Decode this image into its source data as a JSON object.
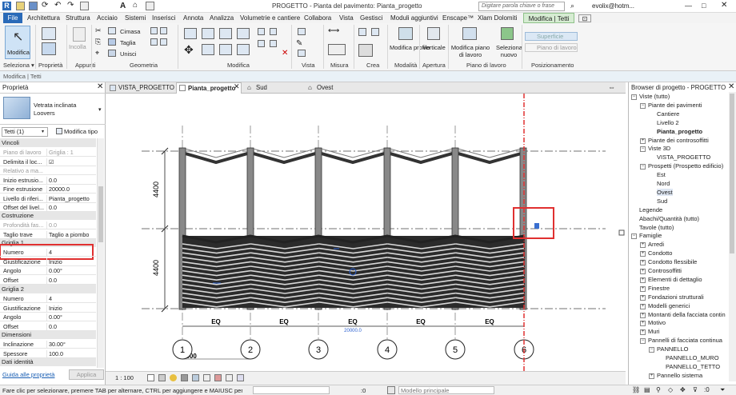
{
  "titlebar": {
    "title": "PROGETTO - Pianta del pavimento: Pianta_progetto",
    "search_placeholder": "Digitare parola chiave o frase",
    "user": "evolix@hotm..."
  },
  "tabs": [
    "File",
    "Architettura",
    "Struttura",
    "Acciaio",
    "Sistemi",
    "Inserisci",
    "Annota",
    "Analizza",
    "Volumetrie e cantiere",
    "Collabora",
    "Vista",
    "Gestisci",
    "Moduli aggiuntivi",
    "Enscape™",
    "Xlam Dolomiti",
    "Modifica | Tetti"
  ],
  "ribbon": {
    "modifica": "Modifica",
    "incolla": "Incolla",
    "cimasa": "Cimasa",
    "taglia": "Taglia",
    "unisci": "Unisci",
    "modifica_profilo": "Modifica profilo",
    "verticale": "Verticale",
    "modifica_piano": "Modifica piano di lavoro",
    "seleziona_nuovo": "Seleziona nuovo",
    "superficie": "Superficie",
    "piano_di_lavoro": "Piano di lavoro",
    "groups": [
      "Seleziona ▾",
      "Proprietà",
      "Appunti",
      "Geometria",
      "Modifica",
      "Vista",
      "Misura",
      "Crea",
      "Modalità",
      "Apertura",
      "Piano di lavoro",
      "Posizionamento"
    ]
  },
  "context_bar": "Modifica | Tetti",
  "properties": {
    "title": "Proprietà",
    "type_name": "Vetrata inclinata Loovers",
    "selector": "Tetti (1)",
    "edit_type": "Modifica tipo",
    "sections": {
      "vincoli": "Vincoli",
      "costruzione": "Costruzione",
      "griglia1": "Griglia 1",
      "griglia2": "Griglia 2",
      "dimensioni": "Dimensioni",
      "dati_identita": "Dati identità"
    },
    "rows_vincoli": [
      [
        "Piano di lavoro",
        "Griglia : 1"
      ],
      [
        "Delimita il loc...",
        "☑"
      ],
      [
        "Relativo a ma...",
        ""
      ],
      [
        "Inizio estrusio...",
        "0.0"
      ],
      [
        "Fine estrusione",
        "20000.0"
      ],
      [
        "Livello di riferi...",
        "Pianta_progetto"
      ],
      [
        "Offset del livel...",
        "0.0"
      ]
    ],
    "rows_costruzione": [
      [
        "Profondità fas...",
        "0.0"
      ],
      [
        "Taglio trave",
        "Taglio a piombo"
      ]
    ],
    "rows_griglia1": [
      [
        "Numero",
        "4"
      ],
      [
        "Giustificazione",
        "Inizio"
      ],
      [
        "Angolo",
        "0.00°"
      ],
      [
        "Offset",
        "0.0"
      ]
    ],
    "rows_griglia2": [
      [
        "Numero",
        "4"
      ],
      [
        "Giustificazione",
        "Inizio"
      ],
      [
        "Angolo",
        "0.00°"
      ],
      [
        "Offset",
        "0.0"
      ]
    ],
    "rows_dimensioni": [
      [
        "Inclinazione",
        "30.00°"
      ],
      [
        "Spessore",
        "100.0"
      ]
    ],
    "help_link": "Guida alle proprietà",
    "apply": "Applica"
  },
  "view_tabs": [
    "VISTA_PROGETTO",
    "Pianta_progetto",
    "Sud",
    "Ovest"
  ],
  "drawing": {
    "dim_left_top": "4400",
    "dim_left_bottom": "4400",
    "eq": "EQ",
    "overall": "20000.0",
    "bay": "4000",
    "grids": [
      "1",
      "2",
      "3",
      "4",
      "5",
      "6"
    ]
  },
  "browser": {
    "title": "Browser di progetto - PROGETTO",
    "items": [
      {
        "t": "Viste (tutto)",
        "l": 1,
        "e": "−"
      },
      {
        "t": "Piante dei pavimenti",
        "l": 2,
        "e": "−"
      },
      {
        "t": "Cantiere",
        "l": 3
      },
      {
        "t": "Livello 2",
        "l": 3
      },
      {
        "t": "Pianta_progetto",
        "l": 3,
        "b": true
      },
      {
        "t": "Piante dei controsoffitti",
        "l": 2,
        "e": "+"
      },
      {
        "t": "Viste 3D",
        "l": 2,
        "e": "−"
      },
      {
        "t": "VISTA_PROGETTO",
        "l": 3
      },
      {
        "t": "Prospetti (Prospetto edificio)",
        "l": 2,
        "e": "−"
      },
      {
        "t": "Est",
        "l": 3
      },
      {
        "t": "Nord",
        "l": 3
      },
      {
        "t": "Ovest",
        "l": 3,
        "s": true
      },
      {
        "t": "Sud",
        "l": 3
      },
      {
        "t": "Legende",
        "l": 1
      },
      {
        "t": "Abachi/Quantità (tutto)",
        "l": 1
      },
      {
        "t": "Tavole (tutto)",
        "l": 1
      },
      {
        "t": "Famiglie",
        "l": 1,
        "e": "−"
      },
      {
        "t": "Arredi",
        "l": 2,
        "e": "+"
      },
      {
        "t": "Condotto",
        "l": 2,
        "e": "+"
      },
      {
        "t": "Condotto flessibile",
        "l": 2,
        "e": "+"
      },
      {
        "t": "Controsoffitti",
        "l": 2,
        "e": "+"
      },
      {
        "t": "Elementi di dettaglio",
        "l": 2,
        "e": "+"
      },
      {
        "t": "Finestre",
        "l": 2,
        "e": "+"
      },
      {
        "t": "Fondazioni strutturali",
        "l": 2,
        "e": "+"
      },
      {
        "t": "Modelli generici",
        "l": 2,
        "e": "+"
      },
      {
        "t": "Montanti della facciata contin",
        "l": 2,
        "e": "+"
      },
      {
        "t": "Motivo",
        "l": 2,
        "e": "+"
      },
      {
        "t": "Muri",
        "l": 2,
        "e": "+"
      },
      {
        "t": "Pannelli di facciata continua",
        "l": 2,
        "e": "−"
      },
      {
        "t": "PANNELLO",
        "l": 3,
        "e": "−"
      },
      {
        "t": "PANNELLO_MURO",
        "l": 4
      },
      {
        "t": "PANNELLO_TETTO",
        "l": 4
      },
      {
        "t": "Pannello sistema",
        "l": 3,
        "e": "+"
      }
    ]
  },
  "viewbar": {
    "scale": "1 : 100"
  },
  "status": {
    "hint": "Fare clic per selezionare, premere TAB per alternare, CTRL per aggiungere e MAIUSC per desel",
    "coord": ":0",
    "model": "Modello principale"
  }
}
